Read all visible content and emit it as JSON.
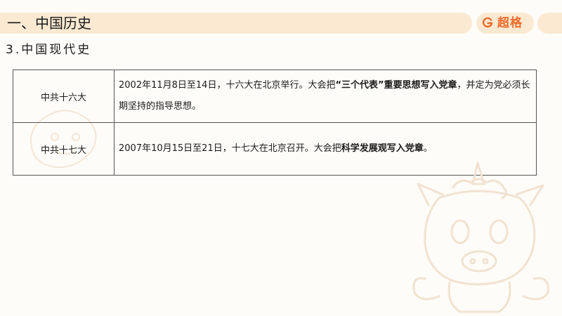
{
  "header": {
    "title": "一、中国历史",
    "logo_text": "超格"
  },
  "section": {
    "title": "3.中国现代史"
  },
  "table": {
    "rows": [
      {
        "label": "中共十六大",
        "segments": [
          {
            "text": "2002年11月8日至14日，十六大在北京举行。大会把",
            "bold": false
          },
          {
            "text": "“三个代表”重要思想写入党章",
            "bold": true
          },
          {
            "text": "，并定为党必须长期坚持的指导思想。",
            "bold": false
          }
        ]
      },
      {
        "label": "中共十七大",
        "segments": [
          {
            "text": "2007年10月15日至21日，十七大在北京召开。大会把",
            "bold": false
          },
          {
            "text": "科学发展观写入党章",
            "bold": true
          },
          {
            "text": "。",
            "bold": false
          }
        ]
      }
    ]
  },
  "colors": {
    "header_bg": "#fbe9d2",
    "brand_orange": "#f06a2a",
    "page_bg": "#fefcf8"
  },
  "icons": {
    "logo": "chaoge-logo-icon",
    "mascot": "unicorn-mascot-watermark"
  }
}
